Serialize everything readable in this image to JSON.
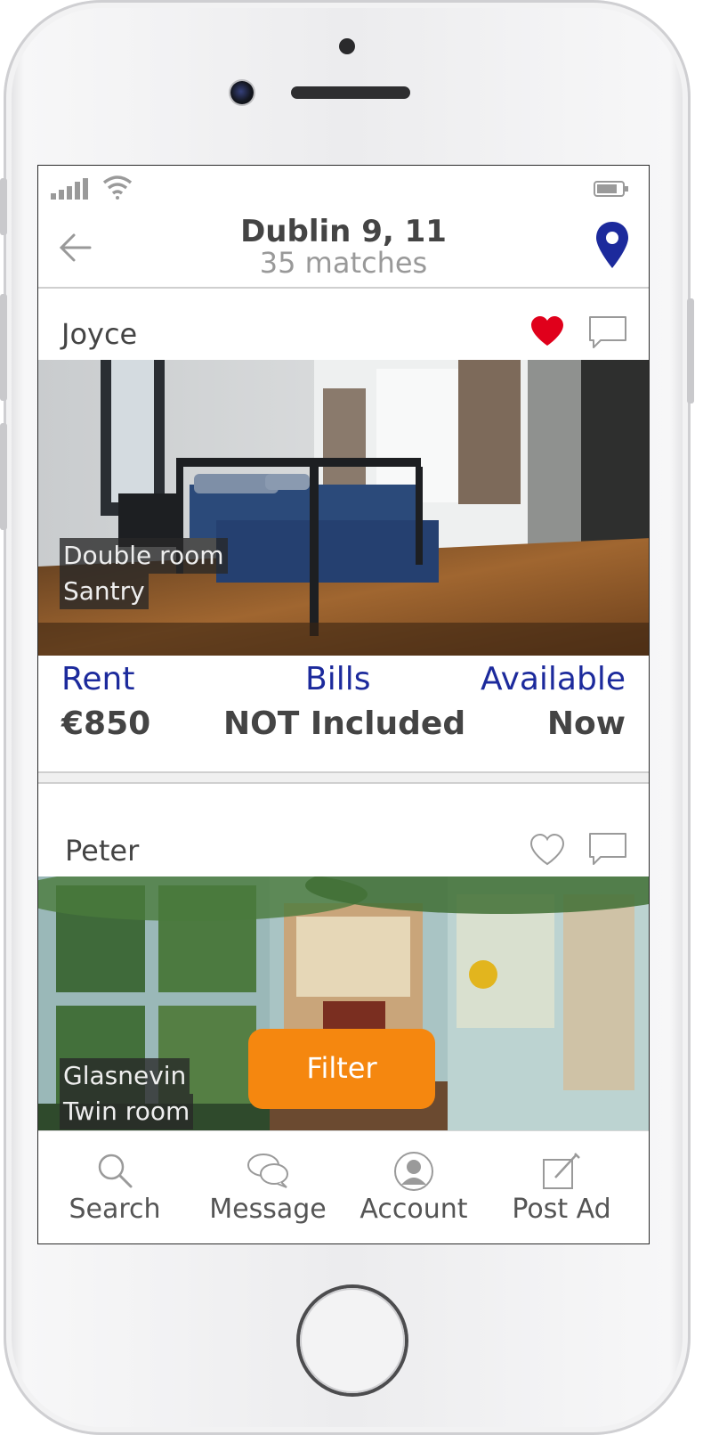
{
  "colors": {
    "accent": "#1c2a9c",
    "filter": "#f5870f",
    "heart_active": "#e0001b"
  },
  "header": {
    "title": "Dublin 9, 11",
    "subtitle": "35 matches"
  },
  "listings": [
    {
      "owner": "Joyce",
      "favorited": true,
      "room_type": "Double room",
      "area": "Santry",
      "rent_label": "Rent",
      "rent_value": "€850",
      "bills_label": "Bills",
      "bills_value": "NOT Included",
      "available_label": "Available",
      "available_value": "Now"
    },
    {
      "owner": "Peter",
      "favorited": false,
      "area": "Glasnevin",
      "room_type": "Twin room"
    }
  ],
  "filter_button": {
    "label": "Filter"
  },
  "tabbar": {
    "items": [
      {
        "label": "Search",
        "icon": "search-icon"
      },
      {
        "label": "Message",
        "icon": "message-icon"
      },
      {
        "label": "Account",
        "icon": "account-icon"
      },
      {
        "label": "Post Ad",
        "icon": "post-ad-icon"
      }
    ]
  }
}
